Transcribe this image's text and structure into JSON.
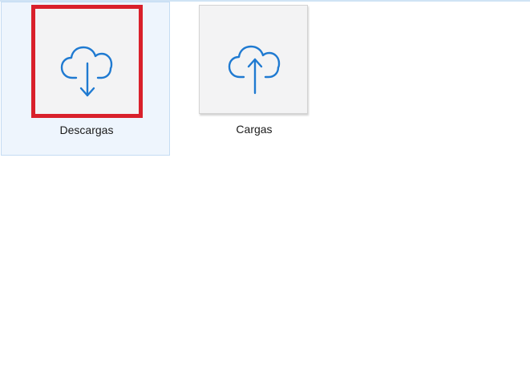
{
  "items": [
    {
      "name": "Descargas",
      "icon": "cloud-download-icon",
      "selected": true,
      "highlight_color": "#d9202b"
    },
    {
      "name": "Cargas",
      "icon": "cloud-upload-icon",
      "selected": false
    }
  ],
  "colors": {
    "icon_stroke": "#1f7ad1",
    "selection_bg": "#eef5fd",
    "selection_border": "#c5dcf3"
  }
}
